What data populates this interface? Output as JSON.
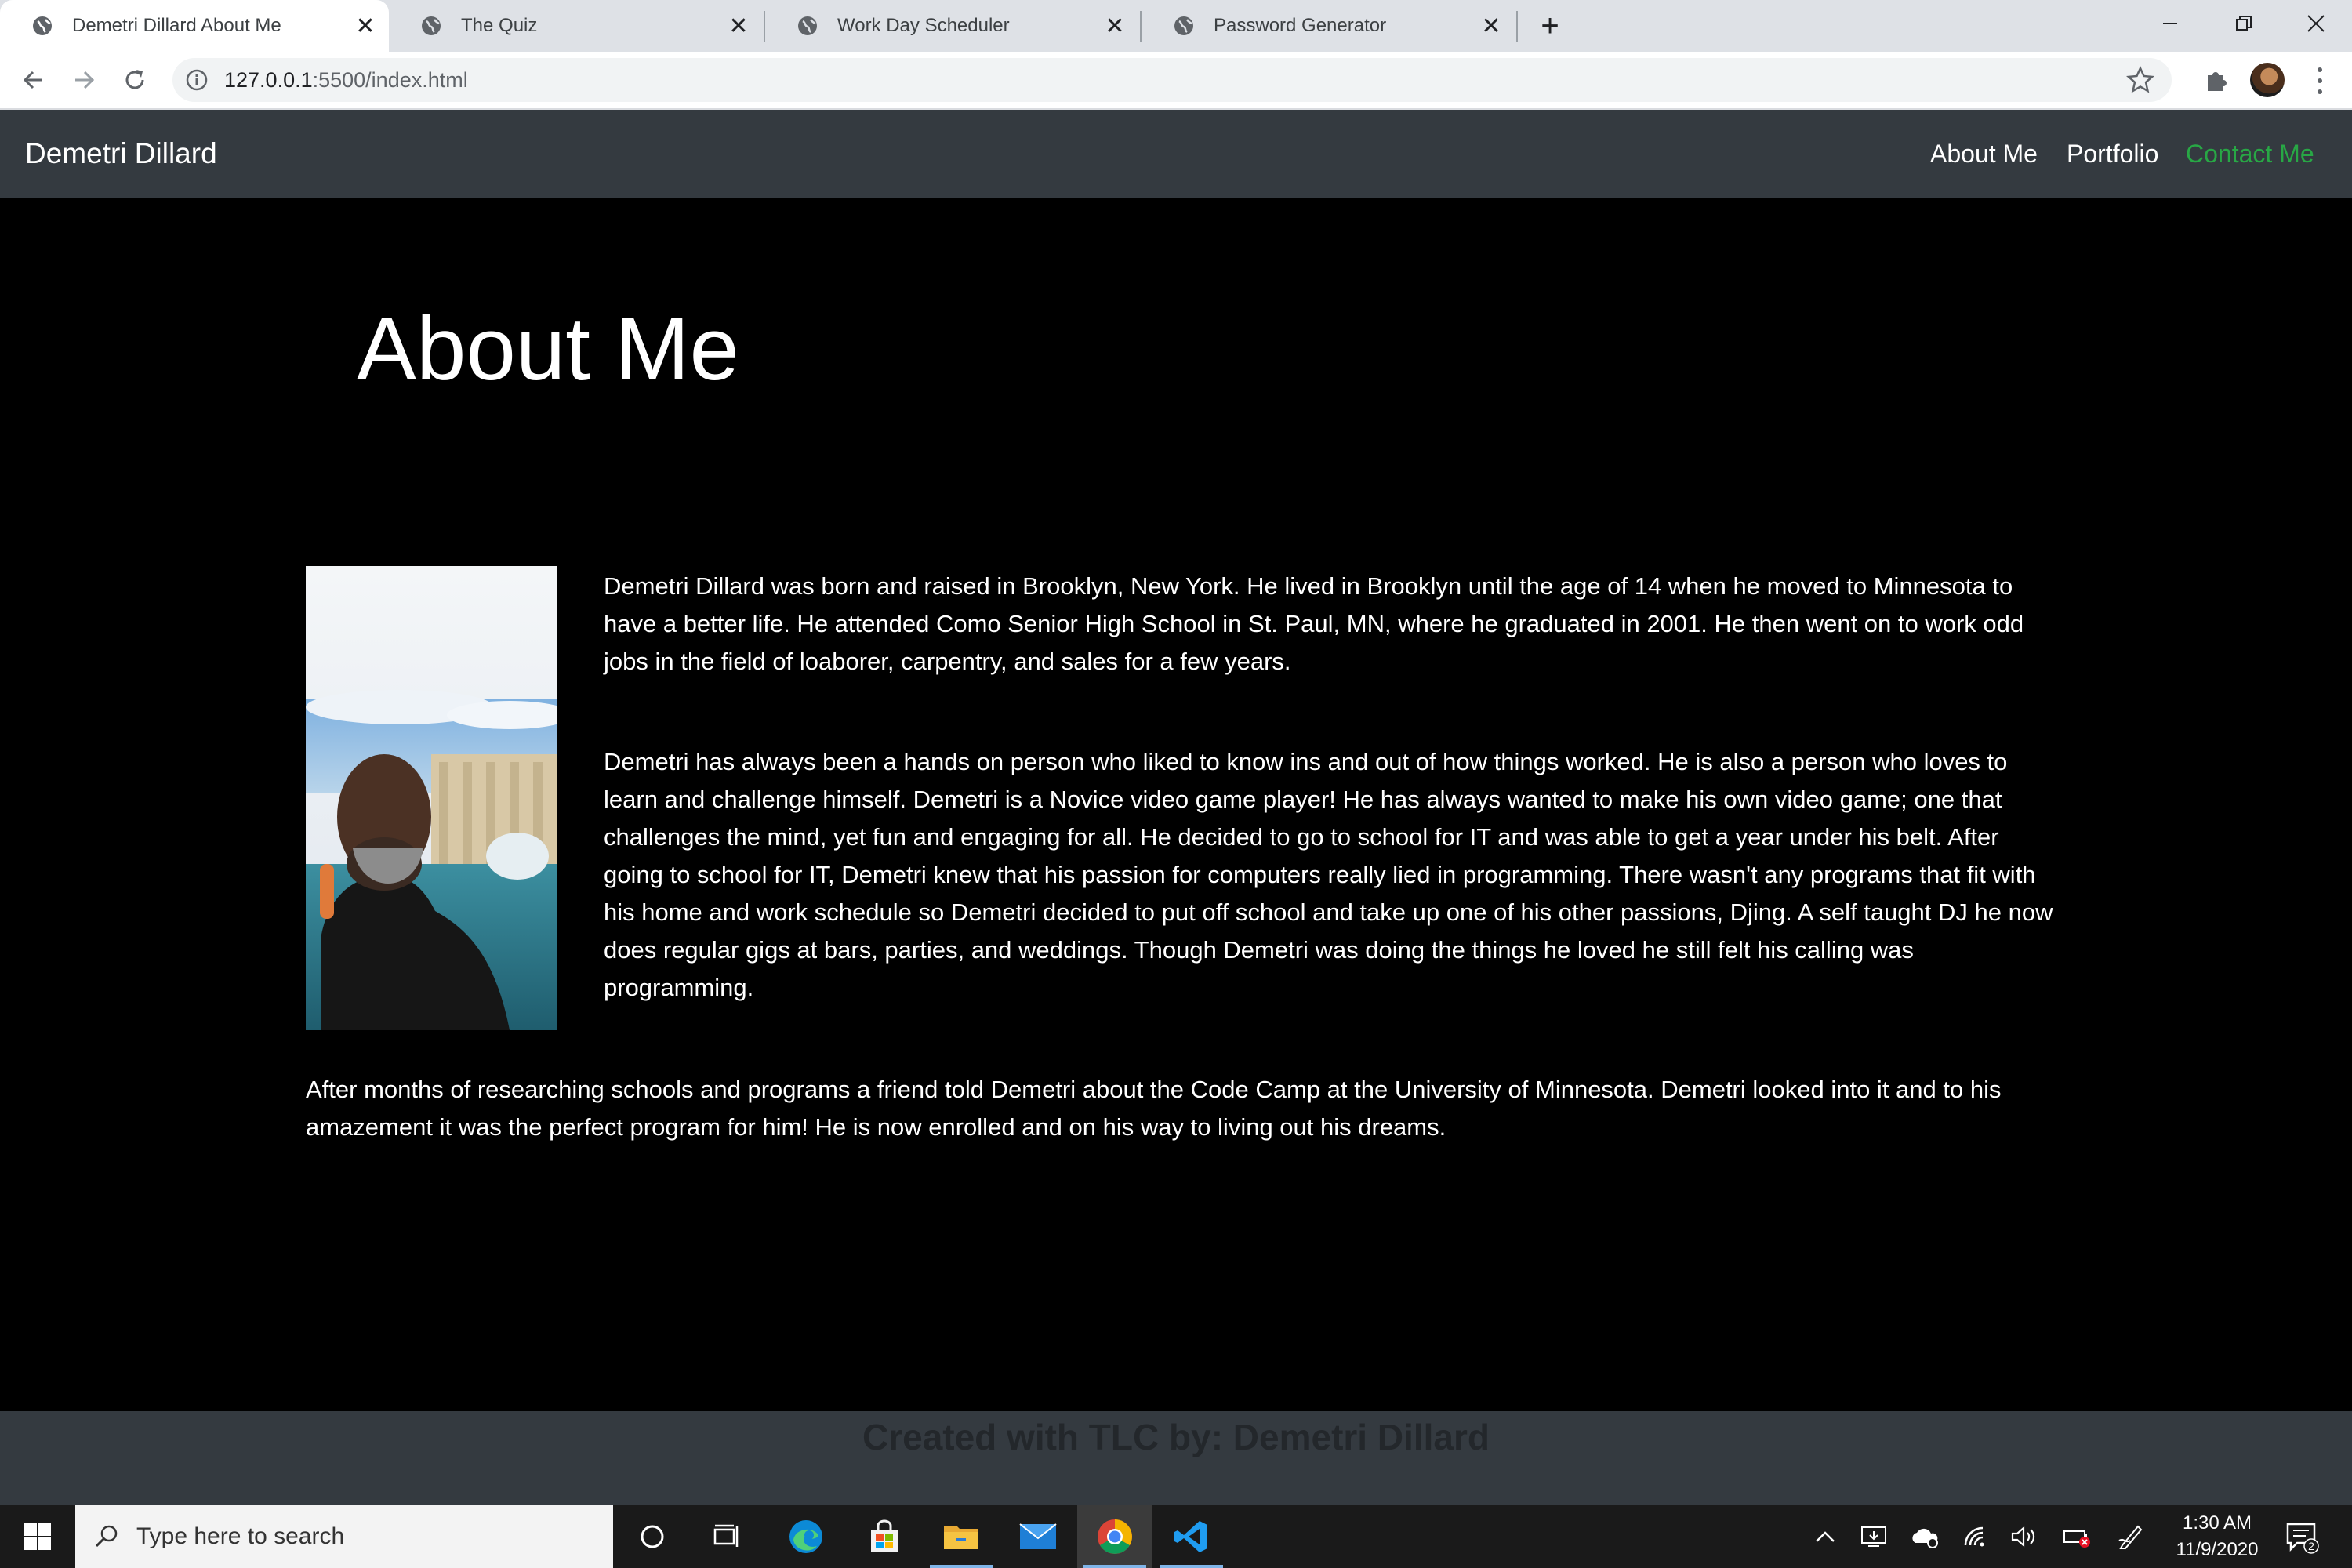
{
  "browser": {
    "tabs": [
      {
        "title": "Demetri Dillard About Me",
        "active": true
      },
      {
        "title": "The Quiz",
        "active": false
      },
      {
        "title": "Work Day Scheduler",
        "active": false
      },
      {
        "title": "Password Generator",
        "active": false
      }
    ],
    "url_host": "127.0.0.1",
    "url_path": ":5500/index.html"
  },
  "navbar": {
    "brand": "Demetri Dillard",
    "links": [
      "About Me",
      "Portfolio",
      "Contact Me"
    ],
    "active_link_color": "#28a745"
  },
  "main": {
    "heading": "About Me",
    "photo_alt": "photo of Demetri Dillard",
    "paragraphs": [
      "Demetri Dillard was born and raised in Brooklyn, New York. He lived in Brooklyn until the age of 14 when he moved to Minnesota to have a better life. He attended Como Senior High School in St. Paul, MN, where he graduated in 2001. He then went on to work odd jobs in the field of loaborer, carpentry, and sales for a few years.",
      "Demetri has always been a hands on person who liked to know ins and out of how things worked. He is also a person who loves to learn and challenge himself. Demetri is a Novice video game player! He has always wanted to make his own video game; one that challenges the mind, yet fun and engaging for all. He decided to go to school for IT and was able to get a year under his belt. After going to school for IT, Demetri knew that his passion for computers really lied in programming. There wasn't any programs that fit with his home and work schedule so Demetri decided to put off school and take up one of his other passions, Djing. A self taught DJ he now does regular gigs at bars, parties, and weddings. Though Demetri was doing the things he loved he still felt his calling was programming.",
      "After months of researching schools and programs a friend told Demetri about the Code Camp at the University of Minnesota. Demetri looked into it and to his amazement it was the perfect program for him! He is now enrolled and on his way to living out his dreams."
    ]
  },
  "footer": {
    "text": "Created with TLC by: Demetri Dillard",
    "icons": [
      "linkedin-icon",
      "github-icon"
    ]
  },
  "taskbar": {
    "search_placeholder": "Type here to search",
    "time": "1:30 AM",
    "date": "11/9/2020",
    "notification_count": "2"
  }
}
